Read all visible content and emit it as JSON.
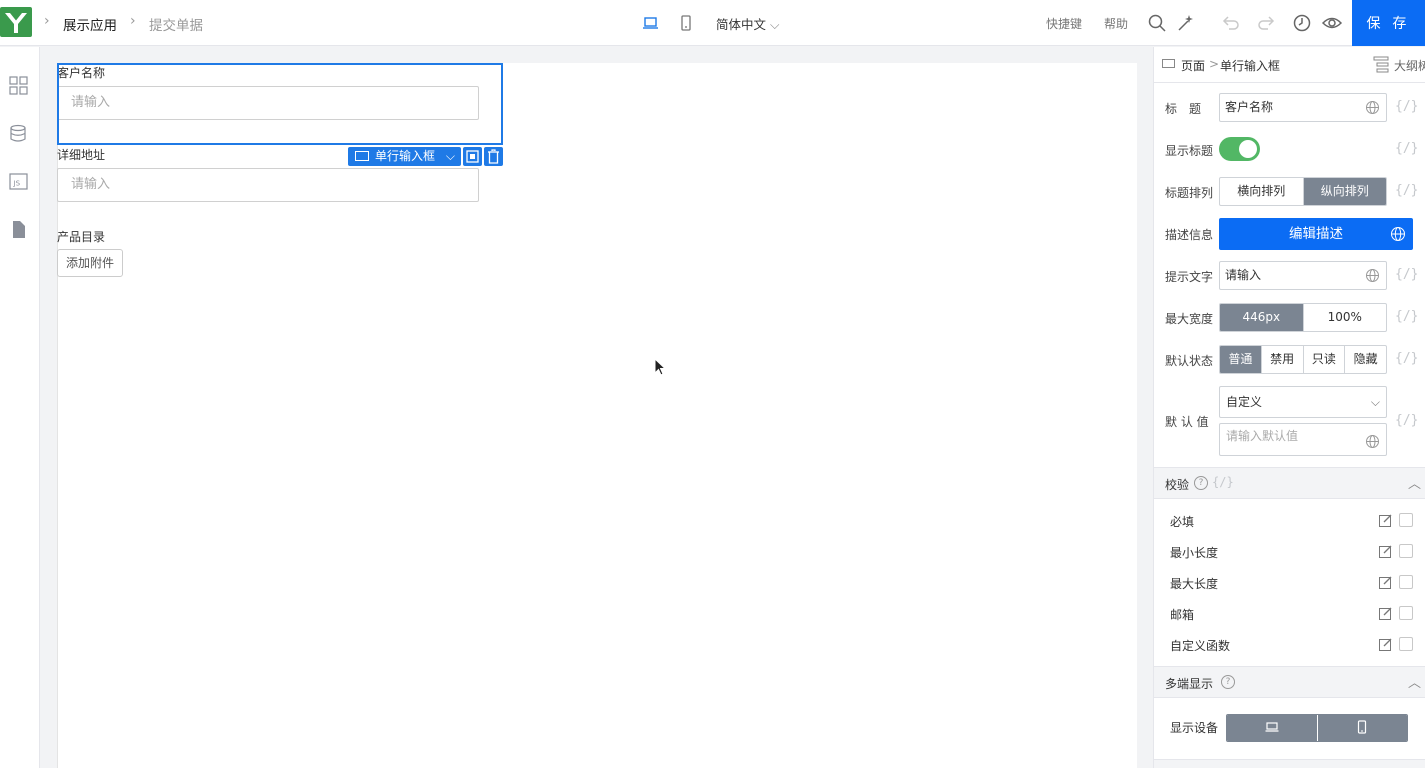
{
  "header": {
    "breadcrumb": [
      "展示应用",
      "提交单据"
    ],
    "language": "简体中文",
    "shortcuts": "快捷键",
    "help": "帮助",
    "save": "保 存"
  },
  "form": {
    "fields": [
      {
        "label": "客户名称",
        "placeholder": "请输入"
      },
      {
        "label": "详细地址",
        "placeholder": "请输入"
      }
    ],
    "catalog_label": "产品目录",
    "attach_button": "添加附件",
    "toolbox_label": "单行输入框"
  },
  "panel": {
    "breadcrumb_page": "页面",
    "breadcrumb_sep": ">",
    "breadcrumb_item": "单行输入框",
    "outline": "大纲树",
    "var": "{/}",
    "title_label": "标　题",
    "title_value": "客户名称",
    "show_title_label": "显示标题",
    "show_title_on": true,
    "title_layout_label": "标题排列",
    "title_layout_options": [
      "横向排列",
      "纵向排列"
    ],
    "desc_label": "描述信息",
    "desc_button": "编辑描述",
    "hint_label": "提示文字",
    "hint_value": "请输入",
    "max_width_label": "最大宽度",
    "max_width_options": [
      "446px",
      "100%"
    ],
    "state_label": "默认状态",
    "state_options": [
      "普通",
      "禁用",
      "只读",
      "隐藏"
    ],
    "default_label": "默 认 值",
    "default_mode": "自定义",
    "default_placeholder": "请输入默认值",
    "validation_title": "校验",
    "validations": [
      "必填",
      "最小长度",
      "最大长度",
      "邮箱",
      "自定义函数"
    ],
    "multi_title": "多端显示",
    "device_label": "显示设备"
  },
  "colors": {
    "accent": "#0b6cf4",
    "selection": "#1f7ae6",
    "toggle_on": "#52b765",
    "segment_on": "#7b8592",
    "logo": "#3a9a4c"
  }
}
